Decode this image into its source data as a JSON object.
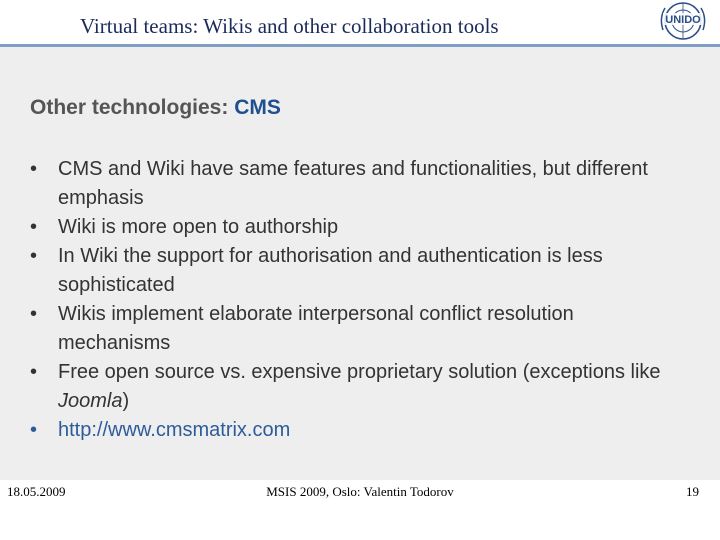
{
  "header": {
    "title": "Virtual teams: Wikis and other collaboration tools",
    "logo_text": "UNIDO"
  },
  "slide": {
    "title_prefix": "Other technologies: ",
    "title_accent": "CMS",
    "bullets": [
      {
        "pre": "CMS and Wiki have same features and functionalities, but different emphasis",
        "em": "",
        "post": ""
      },
      {
        "pre": "Wiki is more open to authorship",
        "em": "",
        "post": ""
      },
      {
        "pre": "In Wiki the support for authorisation and authentication is less sophisticated",
        "em": "",
        "post": ""
      },
      {
        "pre": "Wikis implement elaborate interpersonal conflict resolution mechanisms",
        "em": "",
        "post": ""
      },
      {
        "pre": "Free open source vs. expensive proprietary solution (exceptions like ",
        "em": "Joomla",
        "post": ")"
      }
    ],
    "link_text": "http://www.cmsmatrix.com",
    "bullet_char": "•"
  },
  "footer": {
    "date": "18.05.2009",
    "center": "MSIS 2009, Oslo: Valentin Todorov",
    "page": "19"
  },
  "colors": {
    "accent": "#1f4f8f",
    "rule": "#7f9ec4",
    "content_bg": "#eeeeee",
    "link": "#2e5c9a"
  }
}
